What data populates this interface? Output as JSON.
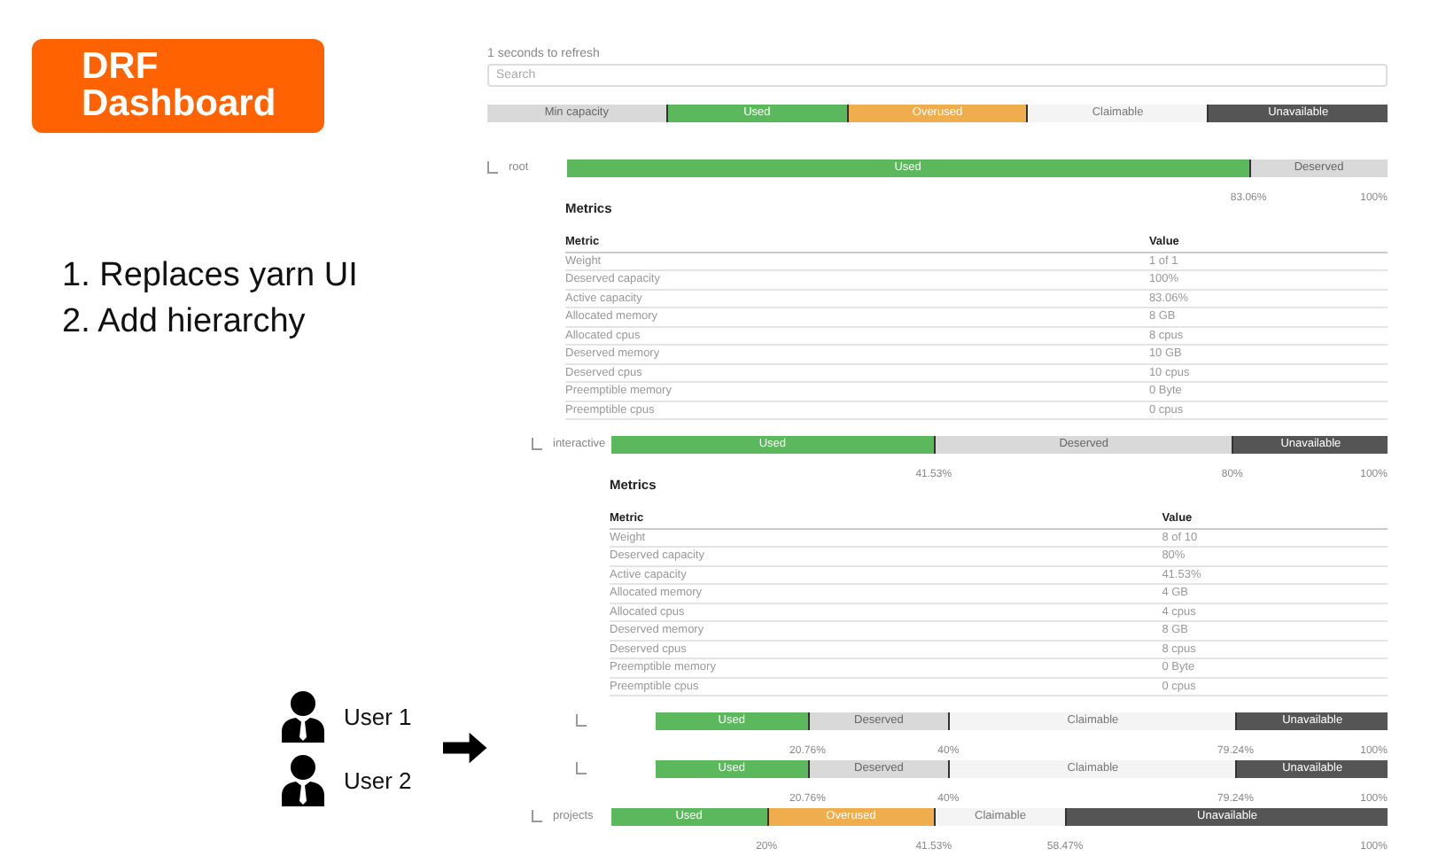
{
  "slide": {
    "title": "DRF Dashboard",
    "points": [
      "1. Replaces yarn UI",
      "2. Add hierarchy"
    ],
    "users": [
      "User 1",
      "User 2"
    ]
  },
  "dashboard": {
    "refresh_text": "1 seconds to refresh",
    "search": {
      "placeholder": "Search"
    },
    "legend": [
      {
        "kind": "min",
        "label": "Min capacity"
      },
      {
        "kind": "used",
        "label": "Used"
      },
      {
        "kind": "overused",
        "label": "Overused"
      },
      {
        "kind": "claimable",
        "label": "Claimable"
      },
      {
        "kind": "unavailable",
        "label": "Unavailable"
      }
    ],
    "queues": [
      {
        "name": "root",
        "segments": [
          {
            "kind": "used",
            "label": "Used",
            "end_label": "83.06%"
          },
          {
            "kind": "deserved",
            "label": "Deserved",
            "end_label": "100%"
          }
        ],
        "metrics": {
          "title": "Metrics",
          "columns": [
            "Metric",
            "Value"
          ],
          "rows": [
            [
              "Weight",
              "1 of 1"
            ],
            [
              "Deserved capacity",
              "100%"
            ],
            [
              "Active capacity",
              "83.06%"
            ],
            [
              "Allocated memory",
              "8 GB"
            ],
            [
              "Allocated cpus",
              "8 cpus"
            ],
            [
              "Deserved memory",
              "10 GB"
            ],
            [
              "Deserved cpus",
              "10 cpus"
            ],
            [
              "Preemptible memory",
              "0 Byte"
            ],
            [
              "Preemptible cpus",
              "0 cpus"
            ]
          ]
        },
        "children": [
          {
            "name": "interactive",
            "segments": [
              {
                "kind": "used",
                "label": "Used",
                "end_label": "41.53%"
              },
              {
                "kind": "deserved",
                "label": "Deserved",
                "end_label": "80%"
              },
              {
                "kind": "unavailable",
                "label": "Unavailable",
                "end_label": "100%"
              }
            ],
            "metrics": {
              "title": "Metrics",
              "columns": [
                "Metric",
                "Value"
              ],
              "rows": [
                [
                  "Weight",
                  "8 of 10"
                ],
                [
                  "Deserved capacity",
                  "80%"
                ],
                [
                  "Active capacity",
                  "41.53%"
                ],
                [
                  "Allocated memory",
                  "4 GB"
                ],
                [
                  "Allocated cpus",
                  "4 cpus"
                ],
                [
                  "Deserved memory",
                  "8 GB"
                ],
                [
                  "Deserved cpus",
                  "8 cpus"
                ],
                [
                  "Preemptible memory",
                  "0 Byte"
                ],
                [
                  "Preemptible cpus",
                  "0 cpus"
                ]
              ]
            },
            "children": [
              {
                "segments": [
                  {
                    "kind": "used",
                    "label": "Used",
                    "end_label": "20.76%"
                  },
                  {
                    "kind": "deserved",
                    "label": "Deserved",
                    "end_label": "40%"
                  },
                  {
                    "kind": "claimable",
                    "label": "Claimable",
                    "end_label": "79.24%"
                  },
                  {
                    "kind": "unavailable",
                    "label": "Unavailable",
                    "end_label": "100%"
                  }
                ]
              },
              {
                "segments": [
                  {
                    "kind": "used",
                    "label": "Used",
                    "end_label": "20.76%"
                  },
                  {
                    "kind": "deserved",
                    "label": "Deserved",
                    "end_label": "40%"
                  },
                  {
                    "kind": "claimable",
                    "label": "Claimable",
                    "end_label": "79.24%"
                  },
                  {
                    "kind": "unavailable",
                    "label": "Unavailable",
                    "end_label": "100%"
                  }
                ]
              }
            ]
          },
          {
            "name": "projects",
            "segments": [
              {
                "kind": "used",
                "label": "Used",
                "end_label": "20%"
              },
              {
                "kind": "overused",
                "label": "Overused",
                "end_label": "41.53%"
              },
              {
                "kind": "claimable",
                "label": "Claimable",
                "end_label": "58.47%"
              },
              {
                "kind": "unavailable",
                "label": "Unavailable",
                "end_label": "100%"
              }
            ]
          }
        ]
      }
    ]
  }
}
